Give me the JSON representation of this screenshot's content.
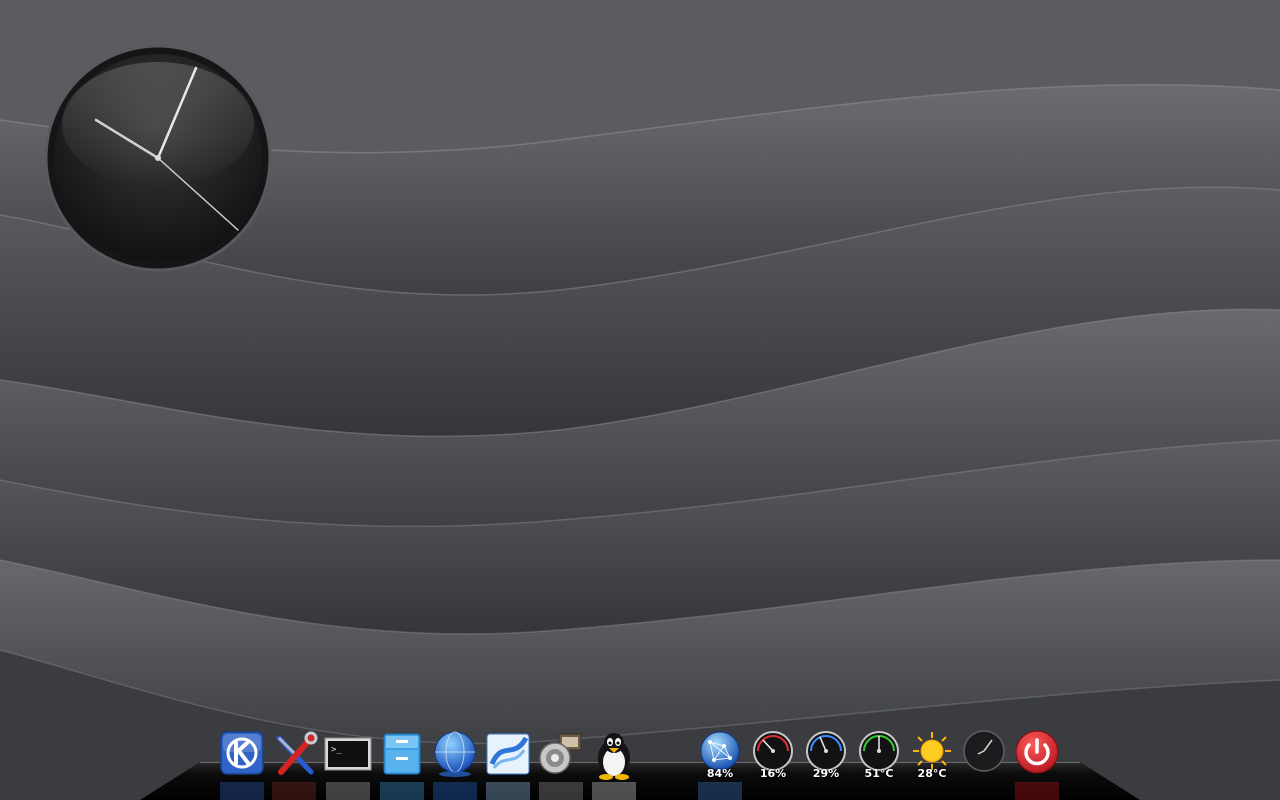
{
  "desktop": {
    "wallpaper": "dark-grey-waves",
    "clock_widget": {
      "style": "analog-dark"
    }
  },
  "dock": {
    "launchers": [
      {
        "icon": "kde-k-icon"
      },
      {
        "icon": "system-settings-icon"
      },
      {
        "icon": "terminal-icon"
      },
      {
        "icon": "file-manager-icon"
      },
      {
        "icon": "web-browser-globe-icon"
      },
      {
        "icon": "office-writer-icon"
      },
      {
        "icon": "audio-speaker-icon"
      },
      {
        "icon": "tux-penguin-icon"
      }
    ],
    "monitors": {
      "network": {
        "icon": "network-globe-icon",
        "label": "84%"
      },
      "cpu": {
        "icon": "gauge-red-icon",
        "label": "16%"
      },
      "memory": {
        "icon": "gauge-blue-icon",
        "label": "29%"
      },
      "temperature": {
        "icon": "gauge-green-icon",
        "label": "51°C"
      },
      "weather": {
        "icon": "sun-weather-icon",
        "label": "28°C"
      }
    },
    "mini_clock": {
      "icon": "mini-clock-icon"
    },
    "power": {
      "icon": "power-button-icon",
      "color": "#d81f26"
    }
  },
  "colors": {
    "background": "#4a4c50",
    "dock_shelf": "#0c0c0c",
    "gauge_red": "#e03030",
    "gauge_blue": "#3a8cff",
    "gauge_green": "#33cc33"
  }
}
